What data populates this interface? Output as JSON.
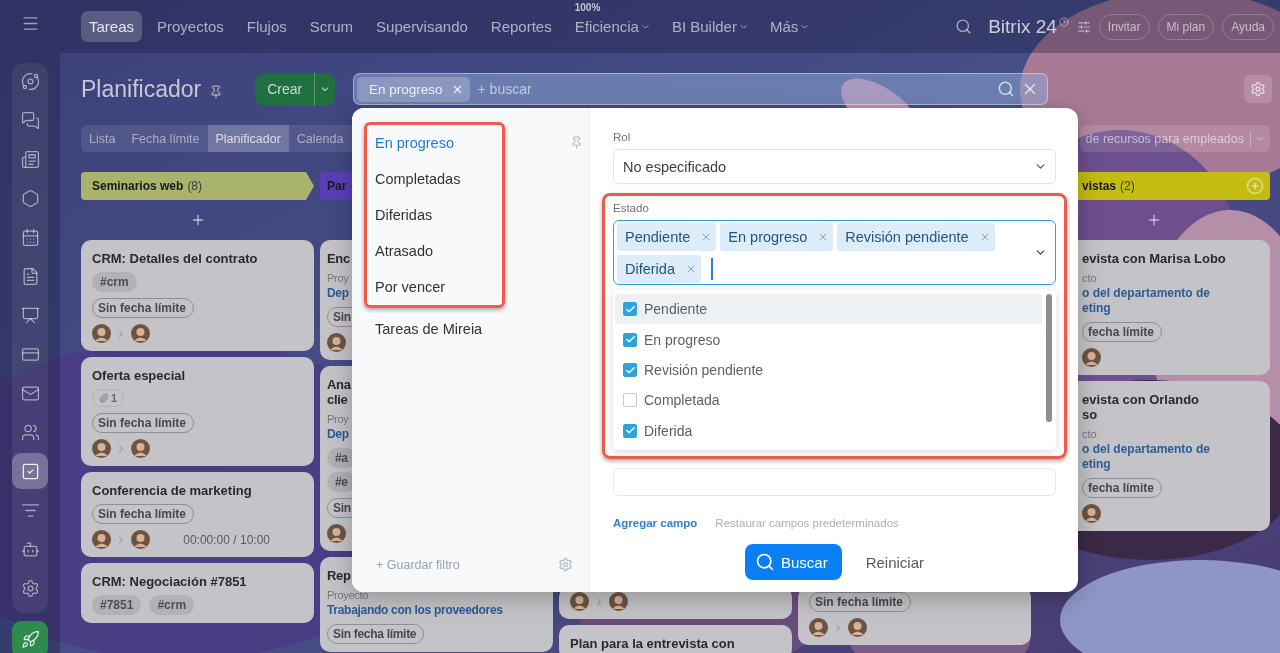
{
  "sidebar": {
    "top": [
      {
        "kind": "menu",
        "selected": false
      }
    ],
    "panel": [
      {
        "kind": "orbit",
        "selected": false
      },
      {
        "kind": "chat",
        "selected": false
      },
      {
        "kind": "news",
        "selected": false
      },
      {
        "kind": "hexagon",
        "selected": false
      },
      {
        "kind": "calendar",
        "selected": false
      },
      {
        "kind": "document",
        "selected": false
      },
      {
        "kind": "board",
        "selected": false
      },
      {
        "kind": "card",
        "selected": false
      },
      {
        "kind": "mail",
        "selected": false
      },
      {
        "kind": "people",
        "selected": false
      },
      {
        "kind": "tasks",
        "selected": true
      },
      {
        "kind": "filter",
        "selected": false
      },
      {
        "kind": "robot",
        "selected": false
      },
      {
        "kind": "settings",
        "selected": false
      }
    ],
    "bottom": [
      {
        "kind": "rocket",
        "selected": false
      }
    ]
  },
  "top_nav": {
    "tabs": [
      {
        "label": "Tareas",
        "selected": true,
        "dropdown": false
      },
      {
        "label": "Proyectos",
        "selected": false,
        "dropdown": false
      },
      {
        "label": "Flujos",
        "selected": false,
        "dropdown": false
      },
      {
        "label": "Scrum",
        "selected": false,
        "dropdown": false
      },
      {
        "label": "Supervisando",
        "selected": false,
        "dropdown": false
      },
      {
        "label": "Reportes",
        "selected": false,
        "dropdown": false
      },
      {
        "label": "Eficiencia",
        "badge": "100%",
        "selected": false,
        "dropdown": true
      },
      {
        "label": "BI Builder",
        "selected": false,
        "dropdown": true
      },
      {
        "label": "Más",
        "selected": false,
        "dropdown": true
      }
    ],
    "logo": "Bitrix 24",
    "buttons": [
      "Invitar",
      "Mi plan",
      "Ayuda"
    ]
  },
  "page": {
    "title": "Planificador",
    "create_button": "Crear"
  },
  "search": {
    "chips": [
      "En progreso"
    ],
    "placeholder": "+ buscar"
  },
  "views": {
    "tabs": [
      {
        "label": "Lista",
        "selected": false
      },
      {
        "label": "Fecha límite",
        "selected": false
      },
      {
        "label": "Planificador",
        "selected": true
      },
      {
        "label": "Calenda",
        "selected": false
      }
    ],
    "resource_select": "de recursos para empleados"
  },
  "columns": [
    {
      "kind": "stage",
      "title": "Seminarios web",
      "count": "(8)",
      "color": "#a9b36d",
      "add_icon": false,
      "cards": [
        {
          "title_lines": [
            "CRM: Detalles del contrato"
          ],
          "tag_rows": [
            [
              "#crm"
            ]
          ],
          "deadline": "Sin fecha límite",
          "people": [
            {
              "kind": "avatar"
            },
            {
              "kind": "avatar"
            }
          ]
        },
        {
          "title_lines": [
            "Oferta especial"
          ],
          "attachments": "1",
          "deadline": "Sin fecha límite",
          "people": [
            {
              "kind": "avatar"
            },
            {
              "kind": "avatar"
            }
          ]
        },
        {
          "title_lines": [
            "Conferencia de marketing"
          ],
          "deadline": "Sin fecha límite",
          "people": [
            {
              "kind": "avatar"
            },
            {
              "kind": "avatar"
            }
          ],
          "timer": "00:00:00 / 10:00"
        },
        {
          "title_lines": [
            "CRM: Negociación #7851"
          ],
          "tag_rows": [
            [
              "#7851",
              "#crm"
            ]
          ]
        }
      ]
    },
    {
      "kind": "covered_right",
      "title": "Par",
      "color": "#5a3fb8",
      "cards": [
        {
          "title_lines": [
            "Enc"
          ],
          "project_label": "Proy",
          "project_lines": [
            "Dep"
          ],
          "deadline": "Sin",
          "people": [
            {
              "kind": "avatar"
            }
          ]
        },
        {
          "title_lines": [
            "Ana",
            "clie"
          ],
          "project_label": "Proy",
          "project_lines": [
            "Dep"
          ],
          "tag_rows": [
            [
              "#a"
            ],
            [
              "#e"
            ]
          ],
          "deadline": "Sin",
          "people": [
            {
              "kind": "avatar"
            }
          ]
        },
        {
          "title_lines": [
            "Rep"
          ],
          "project_label": "Proyecto",
          "project_lines": [
            "Trabajando con los proveedores"
          ],
          "deadline": "Sin fecha límite"
        }
      ]
    },
    {
      "kind": "covered",
      "cards": [
        {
          "people": [
            {
              "kind": "avatar"
            },
            {
              "kind": "avatar"
            }
          ]
        },
        {
          "title_lines": [
            "Plan para la entrevista con"
          ]
        }
      ]
    },
    {
      "kind": "covered",
      "cards": [
        {
          "deadline": "Sin fecha límite",
          "people": [
            {
              "kind": "avatar"
            },
            {
              "kind": "avatar"
            }
          ]
        }
      ]
    },
    {
      "kind": "covered_left",
      "title": "vistas",
      "count": "(2)",
      "color": "#c4bc12",
      "add_icon": true,
      "cards": [
        {
          "title_lines": [
            "evista con Marisa Lobo"
          ],
          "project_label": "cto",
          "project_lines": [
            "o del departamento de",
            "eting"
          ],
          "deadline": "fecha límite",
          "people": [
            {
              "kind": "avatar"
            }
          ]
        },
        {
          "title_lines": [
            "evista con Orlando",
            "so"
          ],
          "project_label": "cto",
          "project_lines": [
            "o del departamento de",
            "eting"
          ],
          "deadline": "fecha límite",
          "people": [
            {
              "kind": "avatar"
            }
          ]
        }
      ]
    }
  ],
  "filter": {
    "presets": [
      {
        "highlighted": true,
        "items": [
          {
            "label": "En progreso",
            "selected": true
          },
          {
            "label": "Completadas",
            "selected": false
          },
          {
            "label": "Diferidas",
            "selected": false
          },
          {
            "label": "Atrasado",
            "selected": false
          },
          {
            "label": "Por vencer",
            "selected": false
          }
        ]
      },
      {
        "highlighted": false,
        "items": [
          {
            "label": "Tareas de Mireia",
            "selected": false
          }
        ]
      }
    ],
    "save_filter": "+ Guardar filtro",
    "fields": [
      {
        "kind": "select",
        "label": "Rol",
        "value": "No especificado",
        "highlighted": false
      },
      {
        "kind": "multiselect",
        "label": "Estado",
        "highlighted": true,
        "chips": [
          "Pendiente",
          "En progreso",
          "Revisión pendiente",
          "Diferida"
        ],
        "options": [
          {
            "label": "Pendiente",
            "checked": true,
            "hovered": true
          },
          {
            "label": "En progreso",
            "checked": true,
            "hovered": false
          },
          {
            "label": "Revisión pendiente",
            "checked": true,
            "hovered": false
          },
          {
            "label": "Completada",
            "checked": false,
            "hovered": false
          },
          {
            "label": "Diferida",
            "checked": true,
            "hovered": false
          }
        ]
      },
      {
        "kind": "empty",
        "highlighted": false
      }
    ],
    "add_field": "Agregar campo",
    "restore_fields": "Restaurar campos predeterminados",
    "search_button": "Buscar",
    "reset_button": "Reiniciar"
  }
}
